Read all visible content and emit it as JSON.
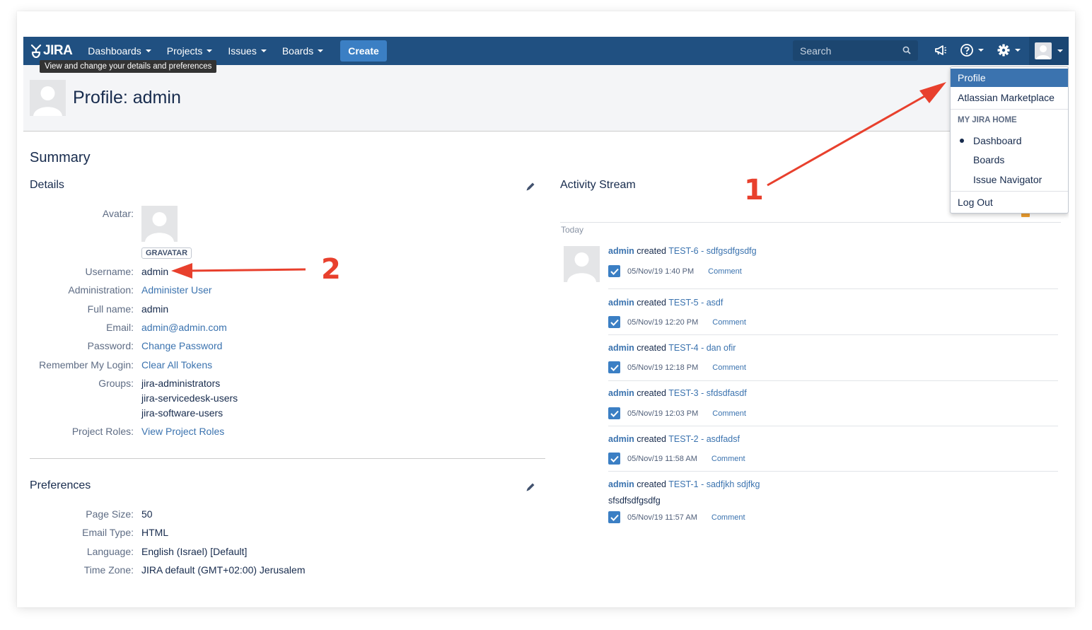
{
  "header": {
    "logo_text": "JIRA",
    "nav": [
      "Dashboards",
      "Projects",
      "Issues",
      "Boards"
    ],
    "create_label": "Create",
    "search_placeholder": "Search",
    "tooltip": "View and change your details and preferences"
  },
  "page": {
    "title": "Profile: admin"
  },
  "summary": {
    "title": "Summary",
    "details_title": "Details",
    "avatar_label": "Avatar:",
    "gravatar": "GRAVATAR",
    "rows": [
      {
        "label": "Username:",
        "value": "admin"
      },
      {
        "label": "Administration:",
        "value": "Administer User"
      },
      {
        "label": "Full name:",
        "value": "admin"
      },
      {
        "label": "Email:",
        "value": "admin@admin.com"
      },
      {
        "label": "Password:",
        "value": "Change Password"
      },
      {
        "label": "Remember My Login:",
        "value": "Clear All Tokens"
      }
    ],
    "groups_label": "Groups:",
    "groups": [
      "jira-administrators",
      "jira-servicedesk-users",
      "jira-software-users"
    ],
    "project_roles_label": "Project Roles:",
    "project_roles_value": "View Project Roles"
  },
  "preferences": {
    "title": "Preferences",
    "rows": [
      {
        "label": "Page Size:",
        "value": "50"
      },
      {
        "label": "Email Type:",
        "value": "HTML"
      },
      {
        "label": "Language:",
        "value": "English (Israel) [Default]"
      },
      {
        "label": "Time Zone:",
        "value": "JIRA default (GMT+02:00) Jerusalem"
      }
    ]
  },
  "activity": {
    "title": "Activity Stream",
    "today": "Today",
    "items": [
      {
        "user": "admin",
        "verb": "created",
        "issue": "TEST-6 - sdfgsdfgsdfg",
        "time": "05/Nov/19 1:40 PM",
        "action": "Comment",
        "desc": ""
      },
      {
        "user": "admin",
        "verb": "created",
        "issue": "TEST-5 - asdf",
        "time": "05/Nov/19 12:20 PM",
        "action": "Comment",
        "desc": ""
      },
      {
        "user": "admin",
        "verb": "created",
        "issue": "TEST-4 - dan ofir",
        "time": "05/Nov/19 12:18 PM",
        "action": "Comment",
        "desc": ""
      },
      {
        "user": "admin",
        "verb": "created",
        "issue": "TEST-3 - sfdsdfasdf",
        "time": "05/Nov/19 12:03 PM",
        "action": "Comment",
        "desc": ""
      },
      {
        "user": "admin",
        "verb": "created",
        "issue": "TEST-2 - asdfadsf",
        "time": "05/Nov/19 11:58 AM",
        "action": "Comment",
        "desc": ""
      },
      {
        "user": "admin",
        "verb": "created",
        "issue": "TEST-1 - sadfjkh sdjfkg",
        "time": "05/Nov/19 11:57 AM",
        "action": "Comment",
        "desc": "sfsdfsdfgsdfg"
      }
    ]
  },
  "user_menu": {
    "profile": "Profile",
    "marketplace": "Atlassian Marketplace",
    "home_heading": "MY JIRA HOME",
    "home_items": [
      "Dashboard",
      "Boards",
      "Issue Navigator"
    ],
    "logout": "Log Out"
  },
  "annotations": {
    "one": "1",
    "two": "2"
  },
  "colors": {
    "header_bg": "#205081",
    "create_bg": "#3b7fc4",
    "link": "#3b73af",
    "annotation": "#e8402d"
  }
}
